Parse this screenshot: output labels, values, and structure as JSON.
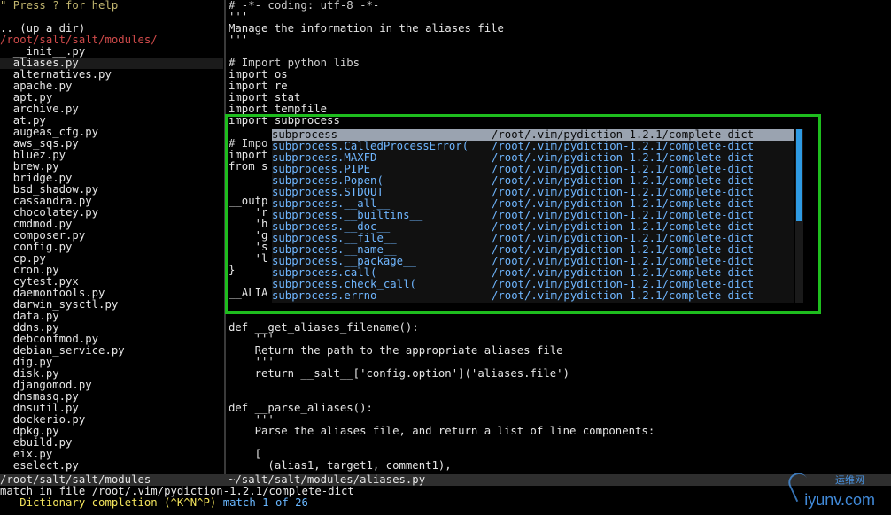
{
  "left_pane": {
    "help": "\" Press ? for help",
    "up_dir": ".. (up a dir)",
    "root_path": "/root/salt/salt/modules/",
    "files": [
      "__init__.py",
      "aliases.py",
      "alternatives.py",
      "apache.py",
      "apt.py",
      "archive.py",
      "at.py",
      "augeas_cfg.py",
      "aws_sqs.py",
      "bluez.py",
      "brew.py",
      "bridge.py",
      "bsd_shadow.py",
      "cassandra.py",
      "chocolatey.py",
      "cmdmod.py",
      "composer.py",
      "config.py",
      "cp.py",
      "cron.py",
      "cytest.pyx",
      "daemontools.py",
      "darwin_sysctl.py",
      "data.py",
      "ddns.py",
      "debconfmod.py",
      "debian_service.py",
      "dig.py",
      "disk.py",
      "djangomod.py",
      "dnsmasq.py",
      "dnsutil.py",
      "dockerio.py",
      "dpkg.py",
      "ebuild.py",
      "eix.py",
      "eselect.py"
    ],
    "selected_index": 1
  },
  "editor": {
    "lines": [
      "# -*- coding: utf-8 -*-",
      "'''",
      "Manage the information in the aliases file",
      "'''",
      "",
      "# Import python libs",
      "import os",
      "import re",
      "import stat",
      "import tempfile",
      "import subprocess",
      "",
      "# Impo",
      "import",
      "from s",
      "",
      "",
      "__outp",
      "    'r",
      "    'h",
      "    'g",
      "    's",
      "    'l",
      "}",
      "",
      "__ALIA",
      "",
      "",
      "def __get_aliases_filename():",
      "    '''",
      "    Return the path to the appropriate aliases file",
      "    '''",
      "    return __salt__['config.option']('aliases.file')",
      "",
      "",
      "def __parse_aliases():",
      "    '''",
      "    Parse the aliases file, and return a list of line components:",
      "",
      "    [",
      "      (alias1, target1, comment1),"
    ]
  },
  "completion": {
    "items": [
      {
        "word": "subprocess",
        "source": "/root/.vim/pydiction-1.2.1/complete-dict"
      },
      {
        "word": "subprocess.CalledProcessError(",
        "source": "/root/.vim/pydiction-1.2.1/complete-dict"
      },
      {
        "word": "subprocess.MAXFD",
        "source": "/root/.vim/pydiction-1.2.1/complete-dict"
      },
      {
        "word": "subprocess.PIPE",
        "source": "/root/.vim/pydiction-1.2.1/complete-dict"
      },
      {
        "word": "subprocess.Popen(",
        "source": "/root/.vim/pydiction-1.2.1/complete-dict"
      },
      {
        "word": "subprocess.STDOUT",
        "source": "/root/.vim/pydiction-1.2.1/complete-dict"
      },
      {
        "word": "subprocess.__all__",
        "source": "/root/.vim/pydiction-1.2.1/complete-dict"
      },
      {
        "word": "subprocess.__builtins__",
        "source": "/root/.vim/pydiction-1.2.1/complete-dict"
      },
      {
        "word": "subprocess.__doc__",
        "source": "/root/.vim/pydiction-1.2.1/complete-dict"
      },
      {
        "word": "subprocess.__file__",
        "source": "/root/.vim/pydiction-1.2.1/complete-dict"
      },
      {
        "word": "subprocess.__name__",
        "source": "/root/.vim/pydiction-1.2.1/complete-dict"
      },
      {
        "word": "subprocess.__package__",
        "source": "/root/.vim/pydiction-1.2.1/complete-dict"
      },
      {
        "word": "subprocess.call(",
        "source": "/root/.vim/pydiction-1.2.1/complete-dict"
      },
      {
        "word": "subprocess.check_call(",
        "source": "/root/.vim/pydiction-1.2.1/complete-dict"
      },
      {
        "word": "subprocess.errno",
        "source": "/root/.vim/pydiction-1.2.1/complete-dict"
      }
    ],
    "selected_index": 0
  },
  "status": {
    "left": "/root/salt/salt/modules",
    "right": "~/salt/salt/modules/aliases.py"
  },
  "messages": {
    "line1": "match in file /root/.vim/pydiction-1.2.1/complete-dict",
    "line2_prefix": "-- Dictionary completion (^K^N^P)",
    "line2_match": "match 1 of 26"
  },
  "watermark": {
    "text": "iyunv.com",
    "subtext": "运维网"
  },
  "colors": {
    "highlight_border": "#1ebd1e",
    "completion_text": "#6fb6ff",
    "selected_row_bg": "#9aa3b0",
    "dir_color": "#d14b4b"
  }
}
